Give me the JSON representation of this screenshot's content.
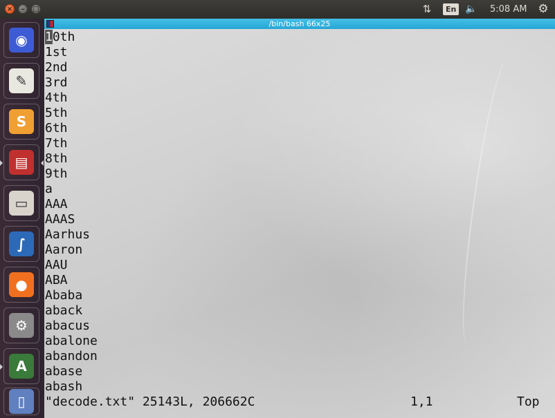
{
  "topbar": {
    "close_glyph": "×",
    "minimize_glyph": "–",
    "maximize_glyph": "□",
    "network_glyph": "⇅",
    "language": "En",
    "volume_glyph": "🔈",
    "clock": "5:08 AM",
    "settings_glyph": "⚙"
  },
  "launcher": {
    "items": [
      {
        "name": "ubuntu-dash-icon",
        "glyph": "◉",
        "color": "#3e5bd6"
      },
      {
        "name": "text-editor-icon",
        "glyph": "✎",
        "color": "#e8e8e0"
      },
      {
        "name": "sublime-text-icon",
        "glyph": "S",
        "color": "#f0a032"
      },
      {
        "name": "terminal-icon",
        "glyph": "▤",
        "color": "#c0302e"
      },
      {
        "name": "file-manager-icon",
        "glyph": "▭",
        "color": "#d8d4cc"
      },
      {
        "name": "wireshark-icon",
        "glyph": "∫",
        "color": "#2c6ab8"
      },
      {
        "name": "firefox-icon",
        "glyph": "●",
        "color": "#f07020"
      },
      {
        "name": "system-tools-icon",
        "glyph": "⚙",
        "color": "#8a8a8a"
      },
      {
        "name": "software-updater-icon",
        "glyph": "A",
        "color": "#3a7a3a"
      },
      {
        "name": "trash-icon",
        "glyph": "▯",
        "color": "#6080c0"
      }
    ]
  },
  "terminal": {
    "title": "/bin/bash 66x25",
    "cursor_char": "1",
    "first_line_rest": "0th",
    "lines": [
      "1st",
      "2nd",
      "3rd",
      "4th",
      "5th",
      "6th",
      "7th",
      "8th",
      "9th",
      "a",
      "AAA",
      "AAAS",
      "Aarhus",
      "Aaron",
      "AAU",
      "ABA",
      "Ababa",
      "aback",
      "abacus",
      "abalone",
      "abandon",
      "abase",
      "abash"
    ],
    "status_file": "\"decode.txt\" 25143L, 206662C",
    "status_position": "1,1",
    "status_scroll": "Top"
  }
}
